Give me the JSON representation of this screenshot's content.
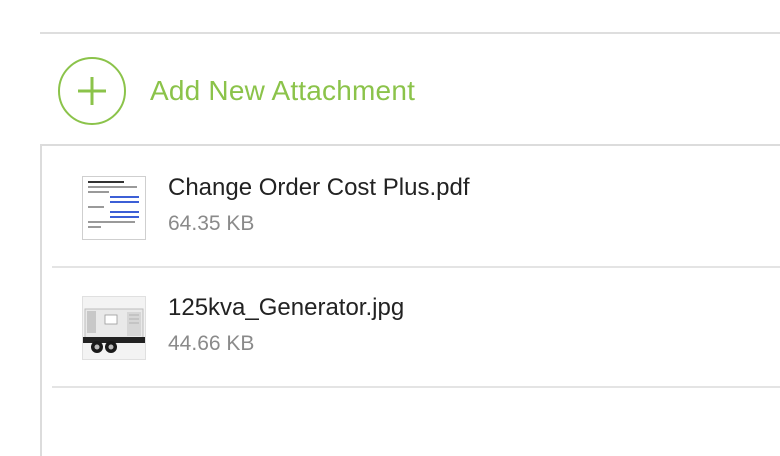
{
  "add_attachment": {
    "label": "Add New Attachment",
    "accent_color": "#8bc34a"
  },
  "attachments": [
    {
      "name": "Change Order Cost Plus.pdf",
      "size": "64.35 KB",
      "icon": "pdf-thumbnail-icon"
    },
    {
      "name": "125kva_Generator.jpg",
      "size": "44.66 KB",
      "icon": "image-thumbnail-icon"
    }
  ]
}
